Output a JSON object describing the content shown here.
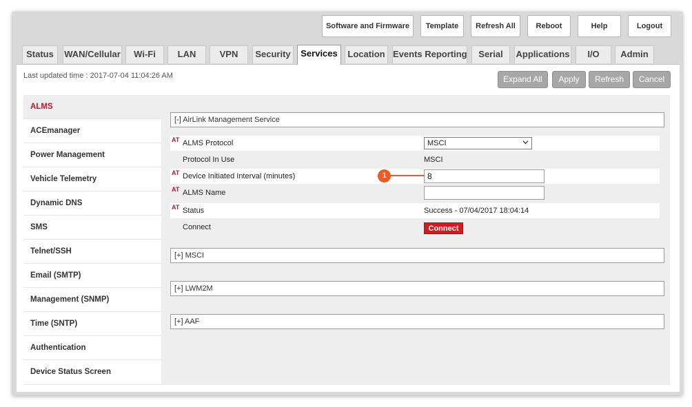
{
  "top_buttons": [
    "Software and Firmware",
    "Template",
    "Refresh All",
    "Reboot",
    "Help",
    "Logout"
  ],
  "tabs": [
    "Status",
    "WAN/Cellular",
    "Wi-Fi",
    "LAN",
    "VPN",
    "Security",
    "Services",
    "Location",
    "Events Reporting",
    "Serial",
    "Applications",
    "I/O",
    "Admin"
  ],
  "active_tab": "Services",
  "last_updated": "Last updated time : 2017-07-04 11:04:26 AM",
  "action_buttons": [
    "Expand All",
    "Apply",
    "Refresh",
    "Cancel"
  ],
  "sidebar": [
    "ALMS",
    "ACEmanager",
    "Power Management",
    "Vehicle Telemetry",
    "Dynamic DNS",
    "SMS",
    "Telnet/SSH",
    "Email (SMTP)",
    "Management (SNMP)",
    "Time (SNTP)",
    "Authentication",
    "Device Status Screen"
  ],
  "sections": {
    "alms": "[-] AirLink Management Service",
    "msci": "[+] MSCI",
    "lwm2m": "[+] LWM2M",
    "aaf": "[+] AAF"
  },
  "at_marker": "AT",
  "fields": {
    "protocol_label": "ALMS Protocol",
    "protocol_value": "MSCI",
    "in_use_label": "Protocol In Use",
    "in_use_value": "MSCI",
    "interval_label": "Device Initiated Interval (minutes)",
    "interval_value": "8",
    "name_label": "ALMS Name",
    "name_value": "",
    "status_label": "Status",
    "status_value": "Success - 07/04/2017 18:04:14",
    "connect_label": "Connect",
    "connect_button": "Connect"
  },
  "callout_number": "1",
  "colors": {
    "accent_red": "#c8102e",
    "callout_orange": "#ee5a24",
    "button_gray": "#a7a7a7"
  }
}
